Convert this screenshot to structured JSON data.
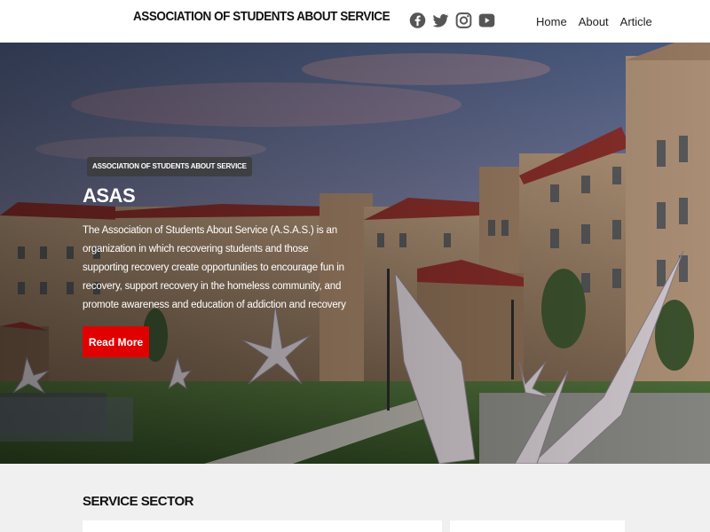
{
  "header": {
    "brand": "ASSOCIATION OF STUDENTS ABOUT SERVICE",
    "social": [
      {
        "icon": "facebook-icon"
      },
      {
        "icon": "twitter-icon"
      },
      {
        "icon": "instagram-icon"
      },
      {
        "icon": "youtube-icon"
      }
    ],
    "nav": [
      {
        "label": "Home"
      },
      {
        "label": "About"
      },
      {
        "label": "Article"
      }
    ]
  },
  "hero": {
    "badge": "ASSOCIATION OF STUDENTS ABOUT SERVICE",
    "title": "ASAS",
    "description": "The Association of Students About Service (A.S.A.S.) is an organization in which recovering students and those supporting recovery create opportunities to encourage fun in recovery, support recovery in the homeless community, and promote awareness and education of addiction and recovery",
    "button": "Read More"
  },
  "service": {
    "title": "SERVICE SECTOR"
  },
  "colors": {
    "accent": "#e00000",
    "icon": "#555555",
    "header_bg": "#ffffff",
    "section_bg": "#f0f0f0"
  }
}
